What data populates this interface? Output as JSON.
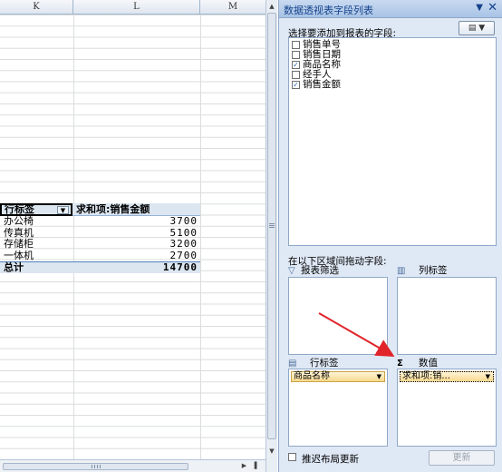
{
  "sheet": {
    "col_headers": [
      "K",
      "L",
      "M"
    ],
    "pivot": {
      "row_header": "行标签",
      "value_header": "求和项:销售金额",
      "rows": [
        {
          "label": "办公椅",
          "value": "3700"
        },
        {
          "label": "传真机",
          "value": "5100"
        },
        {
          "label": "存储柜",
          "value": "3200"
        },
        {
          "label": "一体机",
          "value": "2700"
        }
      ],
      "total_label": "总计",
      "total_value": "14700"
    }
  },
  "field_list": {
    "title": "数据透视表字段列表",
    "choose_label": "选择要添加到报表的字段:",
    "fields": [
      {
        "label": "销售单号",
        "checked": false
      },
      {
        "label": "销售日期",
        "checked": false
      },
      {
        "label": "商品名称",
        "checked": true
      },
      {
        "label": "经手人",
        "checked": false
      },
      {
        "label": "销售金额",
        "checked": true
      }
    ],
    "drag_label": "在以下区域间拖动字段:",
    "areas": {
      "filter_label": "报表筛选",
      "column_label": "列标签",
      "row_label": "行标签",
      "values_label": "数值",
      "row_chip": "商品名称",
      "values_chip": "求和项:销..."
    },
    "defer_label": "推迟布局更新",
    "update_label": "更新"
  },
  "icons": {
    "filter": "filter-icon",
    "columns": "columns-icon",
    "rows": "rows-icon",
    "sigma": "sigma-icon"
  },
  "colors": {
    "pane_bg": "#dfe8f5",
    "pivot_header_bg": "#dce6f1",
    "chip_bg": "#f8d98c",
    "annotation_arrow": "#e0242a"
  }
}
